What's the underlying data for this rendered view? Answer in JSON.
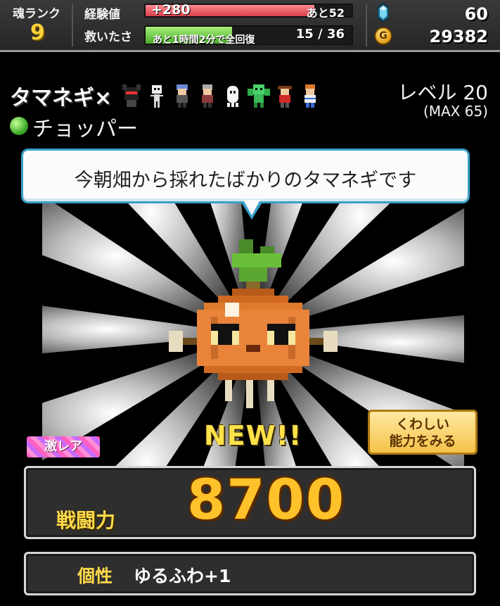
{
  "status": {
    "rank_label": "魂ランク",
    "rank_value": "9",
    "exp_label": "経験値",
    "exp_gain": "+280",
    "exp_remaining": "あと52",
    "exp_progress": 0.82,
    "hp_label": "救いたさ",
    "hp_recover": "あと1時間2分で全回復",
    "hp_value": "15 / 36",
    "hp_progress": 0.42,
    "gems": "60",
    "gold": "29382",
    "coin_symbol": "G"
  },
  "character": {
    "name": "タマネギ×",
    "job": "チョッパー",
    "level": "レベル 20",
    "level_max": "(MAX 65)",
    "speech": "今朝畑から採れたばかりのタマネギです",
    "new_tag": "NEW!!",
    "rarity": "激レア",
    "detail_button": [
      "くわしい",
      "能力をみる"
    ],
    "power_label": "戦闘力",
    "power_value": "8700",
    "trait_label": "個性",
    "trait_value": "ゆるふわ+1"
  },
  "colors": {
    "exp_bar": "#e0505a",
    "hp_bar": "#6ac23a",
    "accent_gold": "#ffc22a"
  }
}
